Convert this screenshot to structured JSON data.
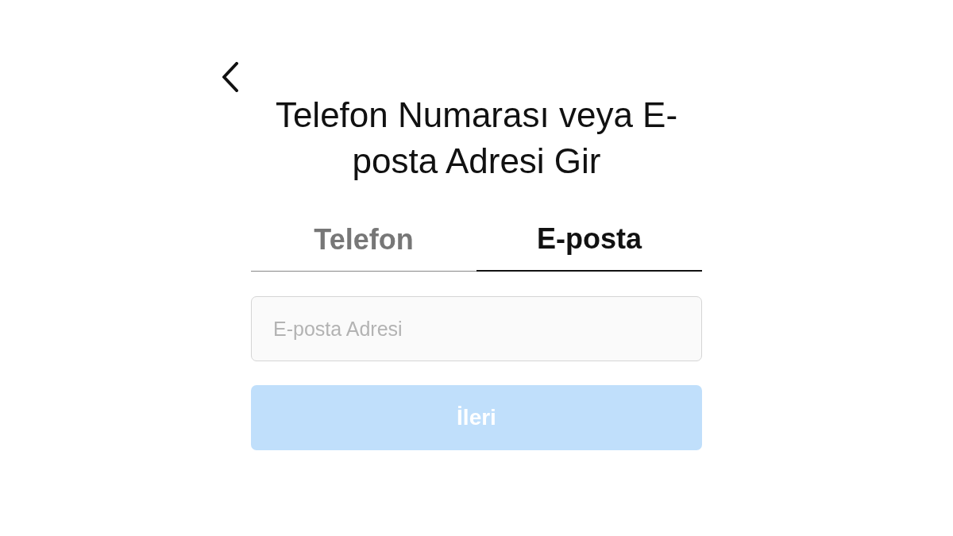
{
  "title": "Telefon Numarası veya E-posta Adresi Gir",
  "tabs": [
    {
      "label": "Telefon",
      "selected": false
    },
    {
      "label": "E-posta",
      "selected": true
    }
  ],
  "email_field": {
    "placeholder": "E-posta Adresi"
  },
  "next_button": {
    "label": "İleri",
    "disabled": true
  }
}
